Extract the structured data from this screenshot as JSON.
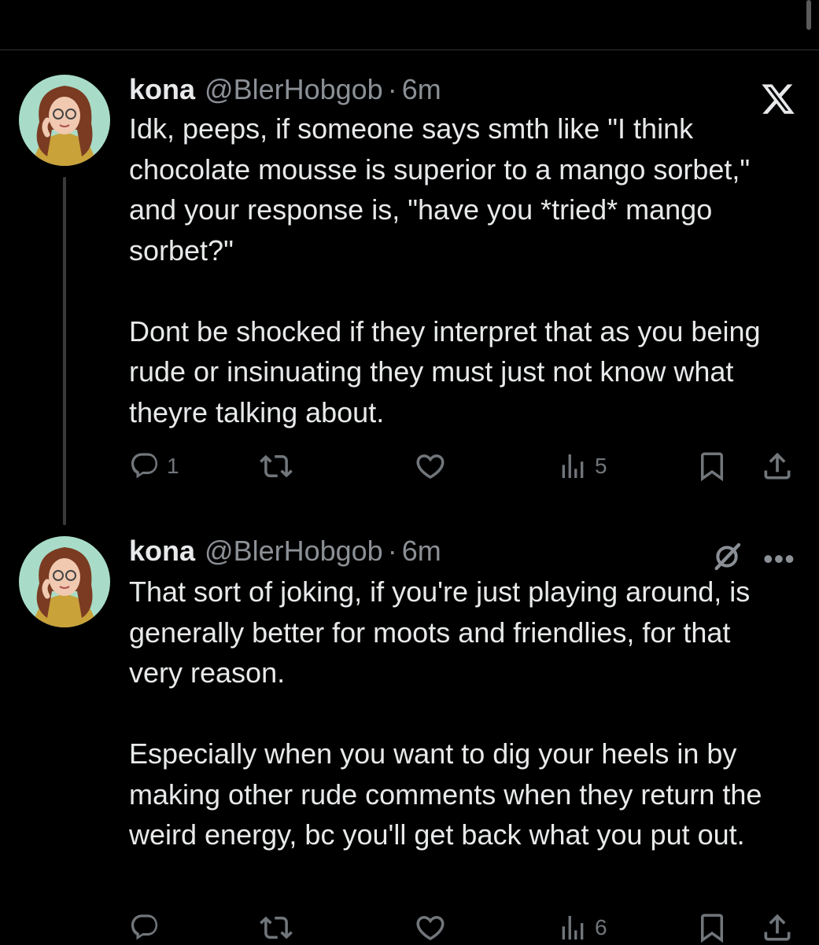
{
  "tweets": [
    {
      "name": "kona",
      "handle": "@BlerHobgob",
      "separator": "·",
      "time": "6m",
      "paragraphs": [
        "Idk, peeps, if someone says smth like  \"I think chocolate mousse is superior to a mango sorbet,\" and your response is, \"have you *tried* mango sorbet?\"",
        "Dont be shocked if they interpret that as you being rude or insinuating they must just not know what theyre talking about."
      ],
      "reply_count": "1",
      "views_count": "5"
    },
    {
      "name": "kona",
      "handle": "@BlerHobgob",
      "separator": "·",
      "time": "6m",
      "paragraphs": [
        "That sort of joking, if you're just playing around, is generally better for moots and friendlies, for that very reason.",
        "Especially when you want to dig your heels in by making other rude comments when they return the weird energy, bc you'll get back what you put out."
      ],
      "reply_count": "",
      "views_count": "6"
    }
  ],
  "more_label": "•••",
  "icons": [
    "x-logo-icon",
    "grok-icon",
    "reply-icon",
    "retweet-icon",
    "like-icon",
    "views-icon",
    "bookmark-icon",
    "share-icon"
  ],
  "colors": {
    "background": "#000000",
    "text": "#e7e9ea",
    "secondary": "#71767b"
  }
}
